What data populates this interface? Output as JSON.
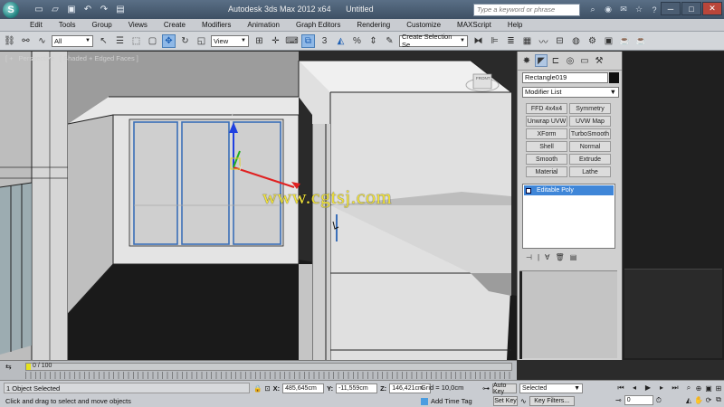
{
  "titlebar": {
    "app_title": "Autodesk 3ds Max  2012 x64",
    "file_title": "Untitled",
    "search_placeholder": "Type a keyword or phrase",
    "logo_letter": "S",
    "minimize": "─",
    "maximize": "□",
    "close": "✕"
  },
  "menu": [
    "Edit",
    "Tools",
    "Group",
    "Views",
    "Create",
    "Modifiers",
    "Animation",
    "Graph Editors",
    "Rendering",
    "Customize",
    "MAXScript",
    "Help"
  ],
  "toolbar": {
    "selection_filter": "All",
    "ref_coord": "View",
    "selection_set": "Create Selection Se",
    "snap_label": "3"
  },
  "viewport": {
    "label_plus": "[ +",
    "label_view": "Perspective",
    "label_shading": "[ Shaded + Edged Faces ]",
    "viewcube_face": "FRONT",
    "watermark": "www.cgtsj.com",
    "gizmo_z": "z",
    "gizmo_y": "y"
  },
  "command_panel": {
    "object_name": "Rectangle019",
    "modifier_list": "Modifier List",
    "modifier_buttons": [
      "FFD 4x4x4",
      "Symmetry",
      "Unwrap UVW",
      "UVW Map",
      "XForm",
      "TurboSmooth",
      "Shell",
      "Normal",
      "Smooth",
      "Extrude",
      "Material",
      "Lathe"
    ],
    "stack_item": "Editable Poly"
  },
  "timeline": {
    "position": "0 / 100"
  },
  "status": {
    "selection": "1 Object Selected",
    "prompt": "Click and drag to select and move objects",
    "x_label": "X:",
    "x_value": "485,645cm",
    "y_label": "Y:",
    "y_value": "-11,559cm",
    "z_label": "Z:",
    "z_value": "146,421cm",
    "grid": "Grid = 10,0cm",
    "add_time_tag": "Add Time Tag",
    "auto_key": "Auto Key",
    "set_key": "Set Key",
    "key_mode": "Selected",
    "key_filters": "Key Filters...",
    "frame": "0"
  },
  "colors": {
    "watermark": "#f1e33a",
    "selection_blue": "#3f86d8",
    "gizmo_x": "#e02020",
    "gizmo_y": "#20b020",
    "gizmo_z": "#2040e0"
  }
}
